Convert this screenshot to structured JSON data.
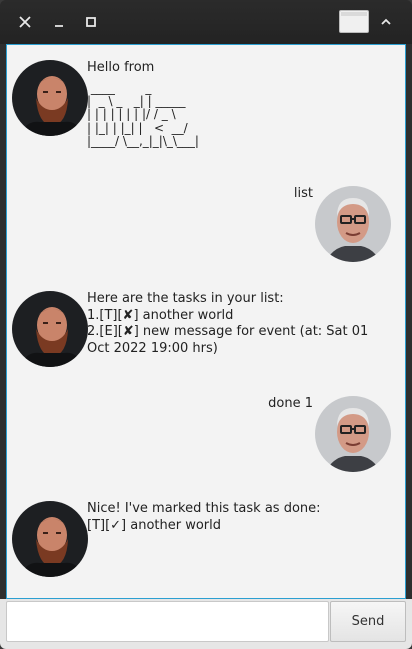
{
  "window": {
    "controls": [
      "close-icon",
      "minimize-icon",
      "maximize-icon",
      "restore-icon",
      "chevron-up-icon"
    ]
  },
  "messages": [
    {
      "sender": "bot",
      "greeting": "Hello from",
      "ascii": " ____        _        \n|  _ \\ _   _| | _____ \n| | | | | | | |/ / _ \\\n| |_| | |_| |   <  __/\n|____/ \\__,_|_|\\_\\___|"
    },
    {
      "sender": "user",
      "text": "list"
    },
    {
      "sender": "bot",
      "text": "Here are the tasks in your list:\n1.[T][✘] another world\n2.[E][✘] new message for event (at: Sat 01\nOct 2022 19:00 hrs)"
    },
    {
      "sender": "user",
      "text": "done 1"
    },
    {
      "sender": "bot",
      "text": "Nice! I've marked this task as done:\n[T][✓] another world"
    }
  ],
  "input": {
    "value": "",
    "placeholder": ""
  },
  "send_label": "Send",
  "colors": {
    "accent_border": "#2b9fd1",
    "chat_bg": "#f3f3f3",
    "titlebar": "#262626"
  }
}
